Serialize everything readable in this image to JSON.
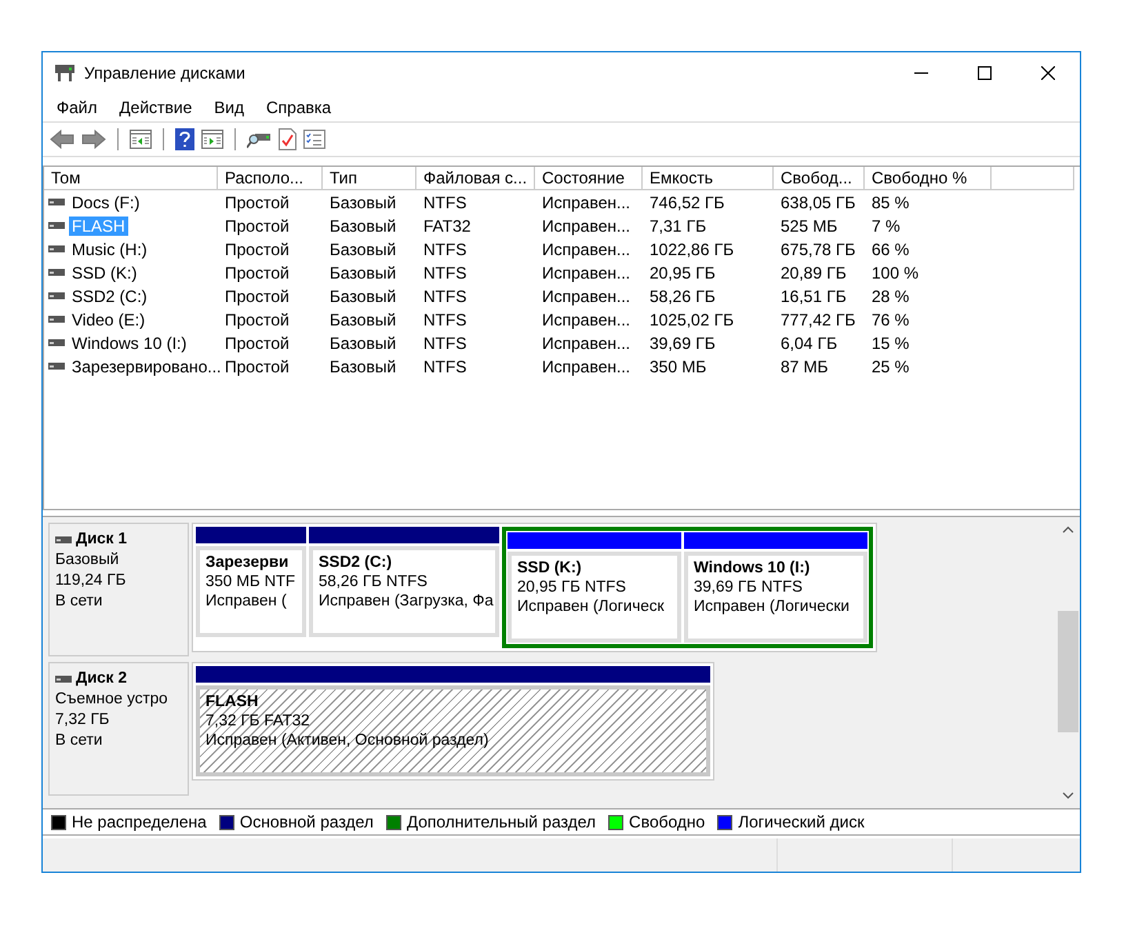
{
  "window": {
    "title": "Управление дисками"
  },
  "menu": [
    "Файл",
    "Действие",
    "Вид",
    "Справка"
  ],
  "table": {
    "columns": [
      "Том",
      "Располо...",
      "Тип",
      "Файловая с...",
      "Состояние",
      "Емкость",
      "Свобод...",
      "Свободно %"
    ],
    "rows": [
      {
        "selected": false,
        "cells": [
          "Docs (F:)",
          "Простой",
          "Базовый",
          "NTFS",
          "Исправен...",
          "746,52 ГБ",
          "638,05 ГБ",
          "85 %"
        ]
      },
      {
        "selected": true,
        "cells": [
          "FLASH",
          "Простой",
          "Базовый",
          "FAT32",
          "Исправен...",
          "7,31 ГБ",
          "525 МБ",
          "7 %"
        ]
      },
      {
        "selected": false,
        "cells": [
          "Music (H:)",
          "Простой",
          "Базовый",
          "NTFS",
          "Исправен...",
          "1022,86 ГБ",
          "675,78 ГБ",
          "66 %"
        ]
      },
      {
        "selected": false,
        "cells": [
          "SSD (K:)",
          "Простой",
          "Базовый",
          "NTFS",
          "Исправен...",
          "20,95 ГБ",
          "20,89 ГБ",
          "100 %"
        ]
      },
      {
        "selected": false,
        "cells": [
          "SSD2 (C:)",
          "Простой",
          "Базовый",
          "NTFS",
          "Исправен...",
          "58,26 ГБ",
          "16,51 ГБ",
          "28 %"
        ]
      },
      {
        "selected": false,
        "cells": [
          "Video (E:)",
          "Простой",
          "Базовый",
          "NTFS",
          "Исправен...",
          "1025,02 ГБ",
          "777,42 ГБ",
          "76 %"
        ]
      },
      {
        "selected": false,
        "cells": [
          "Windows 10 (I:)",
          "Простой",
          "Базовый",
          "NTFS",
          "Исправен...",
          "39,69 ГБ",
          "6,04 ГБ",
          "15 %"
        ]
      },
      {
        "selected": false,
        "cells": [
          "Зарезервировано...",
          "Простой",
          "Базовый",
          "NTFS",
          "Исправен...",
          "350 МБ",
          "87 МБ",
          "25 %"
        ]
      }
    ]
  },
  "disks": [
    {
      "name": "Диск 1",
      "type": "Базовый",
      "size": "119,24 ГБ",
      "status": "В сети",
      "partitions": [
        {
          "kind": "primary",
          "selected": false,
          "label": "Зарезерви",
          "size": "350 МБ NTF",
          "status": "Исправен ("
        },
        {
          "kind": "primary",
          "selected": false,
          "label": "SSD2  (C:)",
          "size": "58,26 ГБ NTFS",
          "status": "Исправен (Загрузка, Фа"
        },
        {
          "kind": "extended",
          "children": [
            {
              "kind": "logical",
              "selected": false,
              "label": "SSD  (K:)",
              "size": "20,95 ГБ NTFS",
              "status": "Исправен (Логическ"
            },
            {
              "kind": "logical",
              "selected": false,
              "label": "Windows 10  (I:)",
              "size": "39,69 ГБ NTFS",
              "status": "Исправен (Логически"
            }
          ]
        }
      ]
    },
    {
      "name": "Диск 2",
      "type": "Съемное устро",
      "size": "7,32 ГБ",
      "status": "В сети",
      "partitions": [
        {
          "kind": "primary",
          "selected": true,
          "label": "FLASH",
          "size": "7,32 ГБ FAT32",
          "status": "Исправен (Активен, Основной раздел)"
        }
      ]
    }
  ],
  "legend": [
    {
      "label": "Не распределена",
      "color": "#000000"
    },
    {
      "label": "Основной раздел",
      "color": "#000080"
    },
    {
      "label": "Дополнительный раздел",
      "color": "#008000"
    },
    {
      "label": "Свободно",
      "color": "#00ff00"
    },
    {
      "label": "Логический диск",
      "color": "#0000ff"
    }
  ]
}
